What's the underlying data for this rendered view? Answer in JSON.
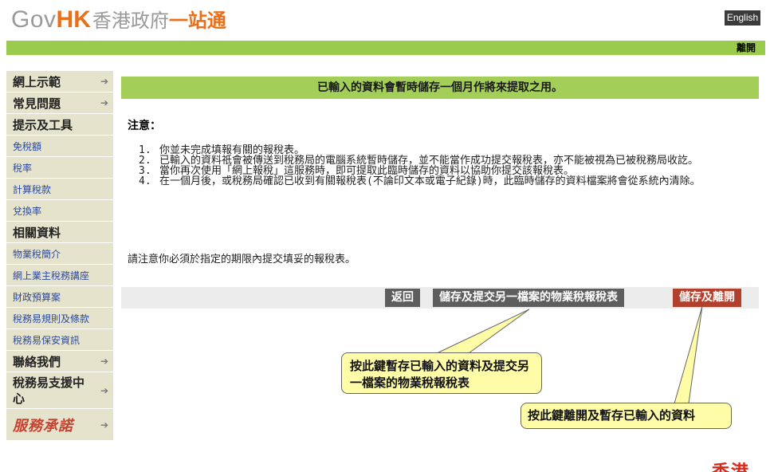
{
  "header": {
    "logo_gov": "Gov",
    "logo_hk": "HK",
    "logo_zh1": "香港政府",
    "logo_zh2": "一站通",
    "language_button": "English",
    "exit_button": "離開"
  },
  "sidebar": {
    "items": [
      {
        "label": "網上示範",
        "kind": "major",
        "arrow": "➔"
      },
      {
        "label": "常見問題",
        "kind": "major",
        "arrow": "➔"
      },
      {
        "label": "提示及工具",
        "kind": "heading"
      },
      {
        "label": "免稅額",
        "kind": "minor"
      },
      {
        "label": "稅率",
        "kind": "minor"
      },
      {
        "label": "計算稅款",
        "kind": "minor"
      },
      {
        "label": "兌換率",
        "kind": "minor"
      },
      {
        "label": "相關資料",
        "kind": "heading"
      },
      {
        "label": "物業稅簡介",
        "kind": "minor"
      },
      {
        "label": "網上業主稅務講座",
        "kind": "minor"
      },
      {
        "label": "財政預算案",
        "kind": "minor"
      },
      {
        "label": "稅務易規則及條款",
        "kind": "minor"
      },
      {
        "label": "稅務易保安資訊",
        "kind": "minor"
      },
      {
        "label": "聯絡我們",
        "kind": "major",
        "arrow": "➔"
      },
      {
        "label": "稅務易支援中心",
        "kind": "tall",
        "arrow": "➔"
      },
      {
        "label": "服務承諾",
        "kind": "logo",
        "arrow": "➔"
      }
    ]
  },
  "main": {
    "notice": "已輸入的資料會暫時儲存一個月作將來提取之用。",
    "note_heading": "注意：",
    "notes": [
      {
        "num": "1.",
        "text": "你並未完成填報有關的報稅表。"
      },
      {
        "num": "2.",
        "text": "已輸入的資料祇會被傳送到稅務局的電腦系統暫時儲存，並不能當作成功提交報稅表，亦不能被視為已被稅務局收訖。"
      },
      {
        "num": "3.",
        "text": "當你再次使用「網上報稅」這服務時，即可提取此臨時儲存的資料以協助你提交該報稅表。"
      },
      {
        "num": "4.",
        "text": "在一個月後，或稅務局確認已收到有關報稅表(不論印文本或電子紀錄)時，此臨時儲存的資料檔案將會從系統內清除。"
      }
    ],
    "deadline_note": "請注意你必須於指定的期限內提交填妥的報稅表。",
    "buttons": {
      "back": "返回",
      "save_another": "儲存及提交另一檔案的物業稅報稅表",
      "save_exit": "儲存及離開"
    }
  },
  "callouts": {
    "save_another": "按此鍵暫存已輸入的資料及提交另一檔案的物業稅報稅表",
    "save_exit": "按此鍵離開及暫存已輸入的資料"
  },
  "corner_text": "香港",
  "colors": {
    "accent_green": "#9bcb4c",
    "sidebar_bg": "#e6e3cd",
    "button_dark": "#5e5e5e",
    "button_red": "#b2402c",
    "callout_bg": "#fffca8"
  }
}
